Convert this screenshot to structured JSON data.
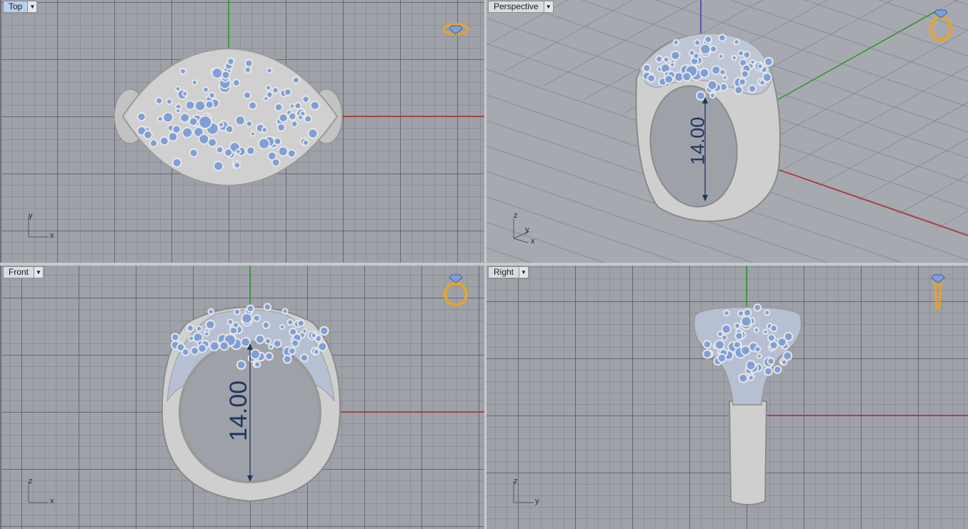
{
  "viewports": {
    "top": {
      "label": "Top"
    },
    "perspective": {
      "label": "Perspective"
    },
    "front": {
      "label": "Front"
    },
    "right": {
      "label": "Right"
    }
  },
  "dimension": {
    "text": "14.00"
  },
  "axes": {
    "top": {
      "a": "y",
      "b": "x"
    },
    "perspective": {
      "a": "z",
      "b": "y",
      "c": "x"
    },
    "front": {
      "a": "z",
      "b": "x"
    },
    "right": {
      "a": "z",
      "b": "y"
    }
  },
  "icons": {
    "dropdown": "chevron-down-icon",
    "ring": "ring-gem-icon"
  },
  "colors": {
    "x_axis": "#b0312b",
    "y_axis": "#2f9a2f",
    "z_axis": "#3b3bb0",
    "gem": "#7f9fd6",
    "metal": "#c9c9c9",
    "dimension": "#1f3560",
    "icon": "#e8a32a",
    "active_tab": "#b8cfee"
  }
}
